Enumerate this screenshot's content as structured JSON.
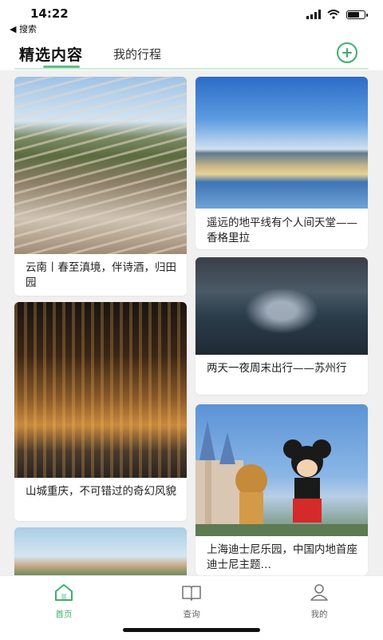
{
  "status_bar": {
    "time": "14:22",
    "back_label": "◀ 搜索"
  },
  "header": {
    "tab_selected": "精选内容",
    "tab_other": "我的行程"
  },
  "cards": [
    {
      "caption": "云南丨春至滇境，伴诗酒，归田园",
      "image_icon": "rice-terraces-image"
    },
    {
      "caption": "遥远的地平线有个人间天堂——香格里拉",
      "image_icon": "lake-horizon-image"
    },
    {
      "caption": "两天一夜周末出行——苏州行",
      "image_icon": "suzhou-night-image"
    },
    {
      "caption": "山城重庆，不可错过的奇幻风貌",
      "image_icon": "chongqing-night-image"
    },
    {
      "caption": "上海迪士尼乐园，中国内地首座迪士尼主题…",
      "image_icon": "disney-castle-image"
    },
    {
      "caption": "",
      "image_icon": "coastal-island-image"
    }
  ],
  "bottom_nav": [
    {
      "label": "首页",
      "icon": "home-icon",
      "active": true
    },
    {
      "label": "查询",
      "icon": "book-icon",
      "active": false
    },
    {
      "label": "我的",
      "icon": "user-icon",
      "active": false
    }
  ],
  "colors": {
    "accent": "#3fae6b",
    "underline": "#5fbf86",
    "background": "#f0f0f0"
  }
}
